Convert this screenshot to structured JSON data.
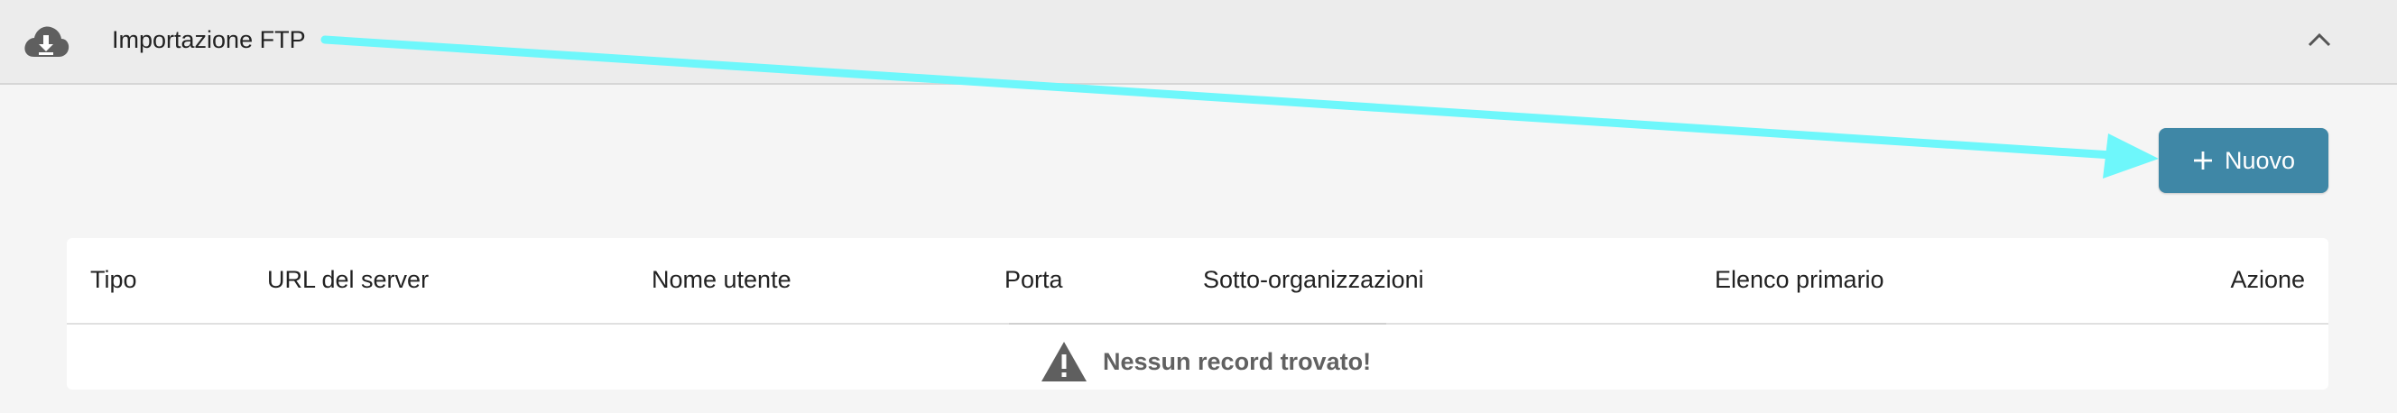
{
  "panel": {
    "title": "Importazione FTP",
    "icon": "cloud-download-icon",
    "collapse_icon": "chevron-up-icon"
  },
  "toolbar": {
    "new_label": "Nuovo",
    "new_icon": "plus-icon",
    "button_color": "#3f87a6"
  },
  "table": {
    "columns": [
      "Tipo",
      "URL del server",
      "Nome utente",
      "Porta",
      "Sotto-organizzazioni",
      "Elenco primario",
      "Azione"
    ],
    "empty_message": "Nessun record trovato!",
    "empty_icon": "warning-icon"
  },
  "annotation": {
    "arrow_color": "#6ef7fb"
  }
}
